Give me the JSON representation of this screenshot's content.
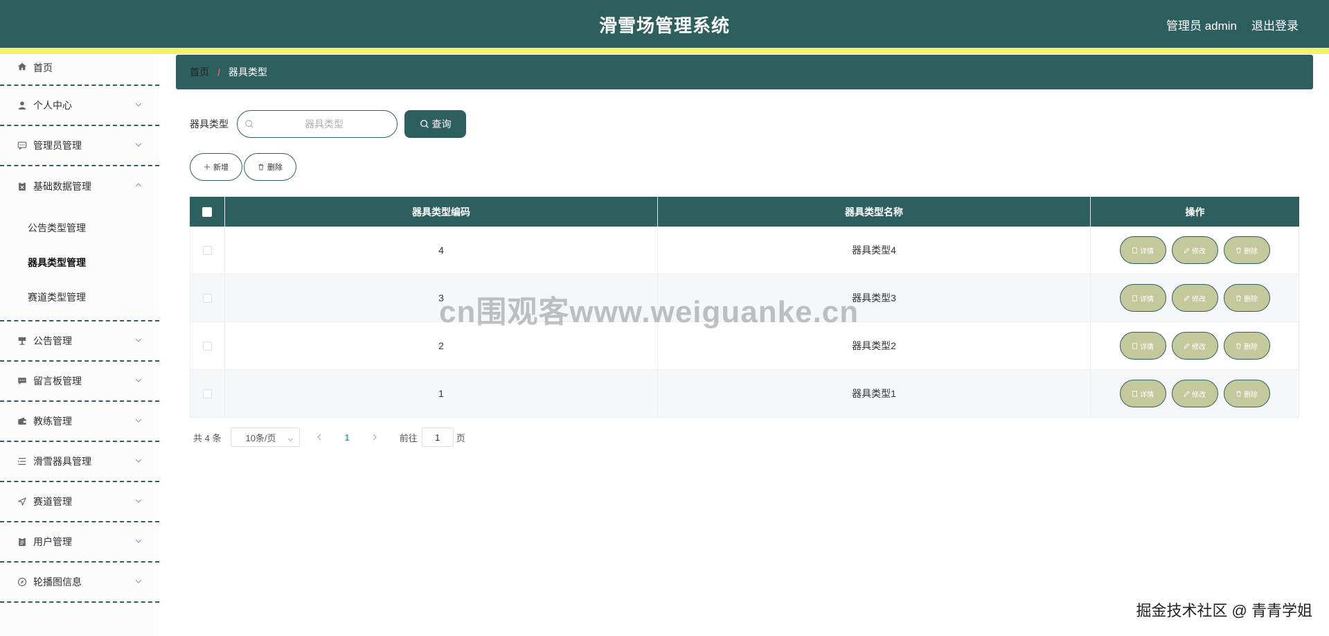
{
  "header": {
    "title": "滑雪场管理系统",
    "user": "管理员 admin",
    "logout": "退出登录"
  },
  "sidebar": {
    "items": [
      {
        "label": "首页",
        "icon": "home-icon"
      },
      {
        "label": "个人中心",
        "icon": "person-icon"
      },
      {
        "label": "管理员管理",
        "icon": "chat-icon"
      },
      {
        "label": "基础数据管理",
        "icon": "clipboard-icon",
        "expanded": true,
        "children": [
          "公告类型管理",
          "器具类型管理",
          "赛道类型管理"
        ],
        "active_child": "器具类型管理"
      },
      {
        "label": "公告管理",
        "icon": "stand-icon"
      },
      {
        "label": "留言板管理",
        "icon": "message-icon"
      },
      {
        "label": "教练管理",
        "icon": "wallet-icon"
      },
      {
        "label": "滑雪器具管理",
        "icon": "list-icon"
      },
      {
        "label": "赛道管理",
        "icon": "navigation-icon"
      },
      {
        "label": "用户管理",
        "icon": "document-icon"
      },
      {
        "label": "轮播图信息",
        "icon": "compass-icon"
      }
    ]
  },
  "breadcrumb": {
    "home": "首页",
    "separator": "/",
    "current": "器具类型"
  },
  "search": {
    "label": "器具类型",
    "placeholder": "器具类型",
    "button": "查询"
  },
  "actions": {
    "add": "新增",
    "delete": "删除"
  },
  "table": {
    "columns": [
      "器具类型编码",
      "器具类型名称",
      "操作"
    ],
    "rows": [
      {
        "code": "4",
        "name": "器具类型4"
      },
      {
        "code": "3",
        "name": "器具类型3"
      },
      {
        "code": "2",
        "name": "器具类型2"
      },
      {
        "code": "1",
        "name": "器具类型1"
      }
    ],
    "ops": {
      "detail": "详情",
      "edit": "修改",
      "delete": "删除"
    }
  },
  "pagination": {
    "total": "共 4 条",
    "page_size": "10条/页",
    "current_page": "1",
    "goto_label": "前往",
    "goto_value": "1",
    "goto_suffix": "页"
  },
  "watermark": "cn围观客www.weiguanke.cn",
  "credit": "掘金技术社区 @ 青青学姐",
  "colors": {
    "primary": "#2e5f5f",
    "accent_bar": "#f3f169",
    "op_button": "#c4c99b",
    "active_page": "#2bae9a"
  }
}
